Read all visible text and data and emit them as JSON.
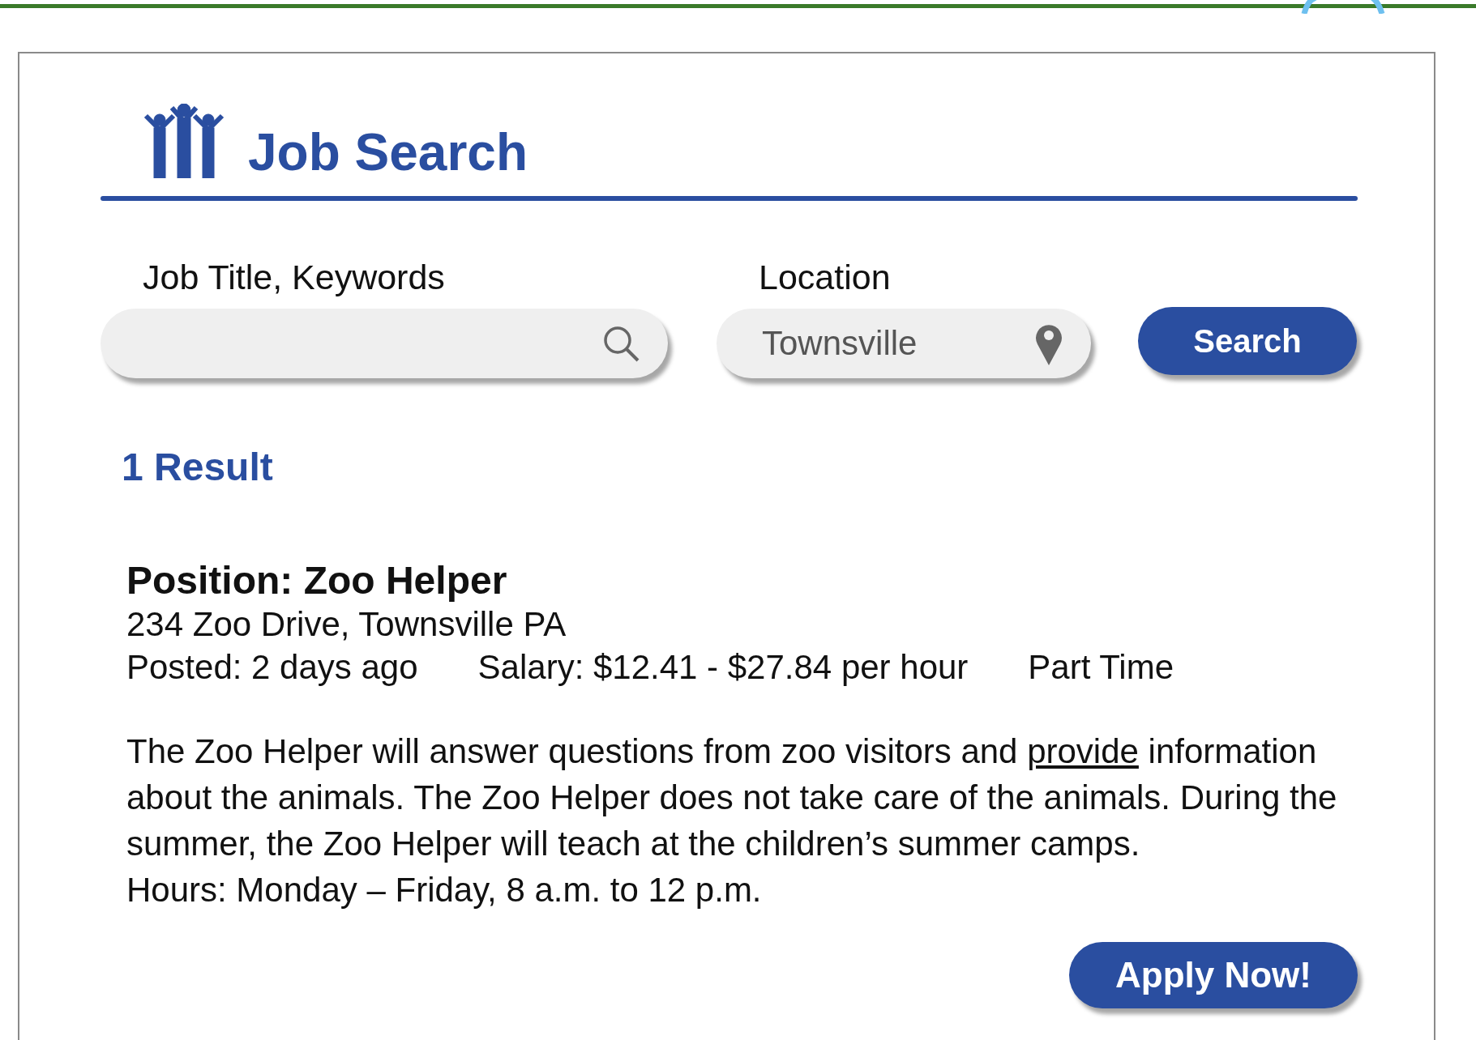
{
  "header": {
    "title": "Job Search"
  },
  "search": {
    "keywords": {
      "label": "Job Title, Keywords"
    },
    "location": {
      "label": "Location",
      "value": "Townsville"
    },
    "button": "Search"
  },
  "results_count": "1 Result",
  "job": {
    "title": "Position: Zoo Helper",
    "address": "234 Zoo Drive, Townsville PA",
    "meta": [
      "Posted: 2 days ago",
      "Salary: $12.41 - $27.84 per hour",
      "Part Time"
    ],
    "description": {
      "before": "The Zoo Helper will answer questions from zoo visitors and ",
      "link": "provide",
      "after": " information about the animals. The Zoo Helper does not take care of the animals. During the summer, the Zoo Helper will teach at the children’s summer camps."
    },
    "hours": "Hours: Monday – Friday, 8 a.m. to 12 p.m.",
    "apply_button": "Apply Now!"
  }
}
